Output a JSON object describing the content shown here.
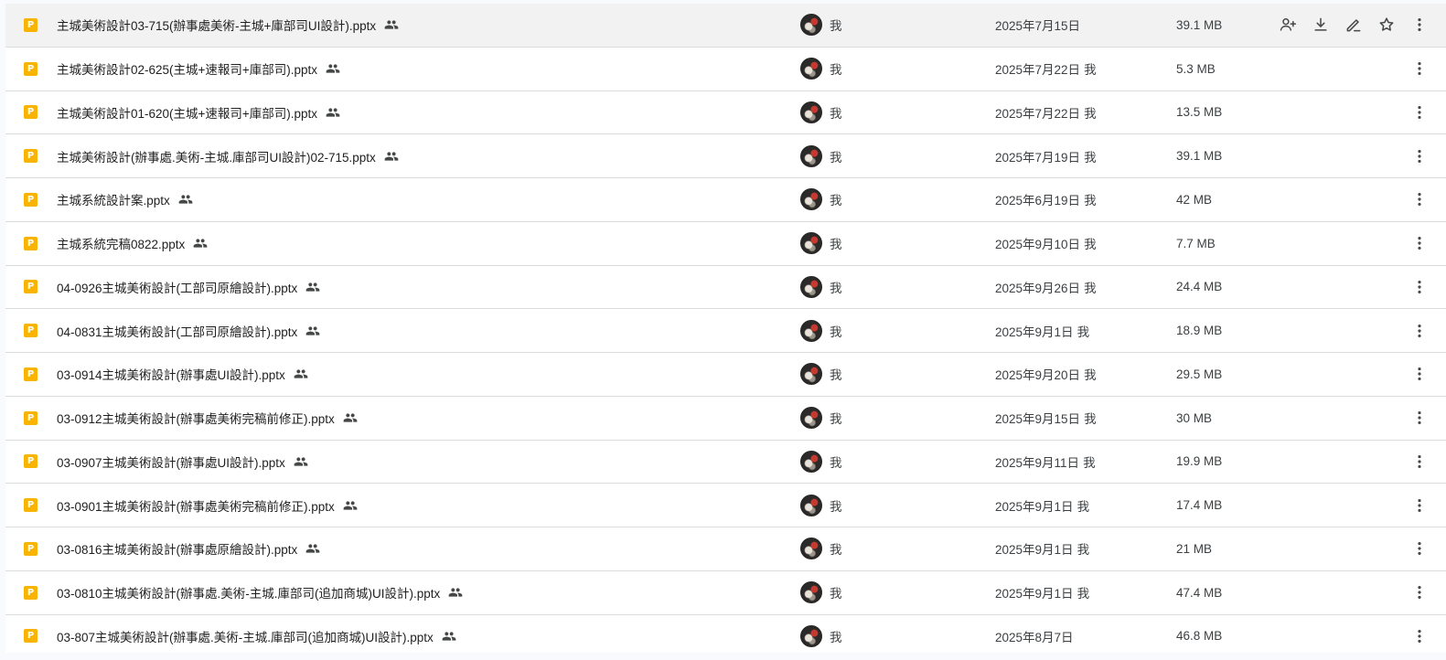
{
  "colors": {
    "file_type_badge": "#f8b400",
    "row_hover": "#f2f2f2",
    "divider": "#dadce0",
    "text": "#1f1f1f"
  },
  "file_type_letter": "P",
  "owner_label": "我",
  "hover_actions": [
    "share-icon",
    "download-icon",
    "rename-icon",
    "star-icon"
  ],
  "files": [
    {
      "name": "主城美術設計03-715(辦事處美術-主城+庫部司UI設計).pptx",
      "owner": "我",
      "modified": "2025年7月15日",
      "modified_by": "",
      "size": "39.1 MB",
      "hovered": true
    },
    {
      "name": "主城美術設計02-625(主城+速報司+庫部司).pptx",
      "owner": "我",
      "modified": "2025年7月22日",
      "modified_by": "我",
      "size": "5.3 MB"
    },
    {
      "name": "主城美術設計01-620(主城+速報司+庫部司).pptx",
      "owner": "我",
      "modified": "2025年7月22日",
      "modified_by": "我",
      "size": "13.5 MB"
    },
    {
      "name": "主城美術設計(辦事處.美術-主城.庫部司UI設計)02-715.pptx",
      "owner": "我",
      "modified": "2025年7月19日",
      "modified_by": "我",
      "size": "39.1 MB"
    },
    {
      "name": "主城系統設計案.pptx",
      "owner": "我",
      "modified": "2025年6月19日",
      "modified_by": "我",
      "size": "42 MB"
    },
    {
      "name": "主城系統完稿0822.pptx",
      "owner": "我",
      "modified": "2025年9月10日",
      "modified_by": "我",
      "size": "7.7 MB"
    },
    {
      "name": "04-0926主城美術設計(工部司原繪設計).pptx",
      "owner": "我",
      "modified": "2025年9月26日",
      "modified_by": "我",
      "size": "24.4 MB"
    },
    {
      "name": "04-0831主城美術設計(工部司原繪設計).pptx",
      "owner": "我",
      "modified": "2025年9月1日",
      "modified_by": "我",
      "size": "18.9 MB"
    },
    {
      "name": "03-0914主城美術設計(辦事處UI設計).pptx",
      "owner": "我",
      "modified": "2025年9月20日",
      "modified_by": "我",
      "size": "29.5 MB"
    },
    {
      "name": "03-0912主城美術設計(辦事處美術完稿前修正).pptx",
      "owner": "我",
      "modified": "2025年9月15日",
      "modified_by": "我",
      "size": "30 MB"
    },
    {
      "name": "03-0907主城美術設計(辦事處UI設計).pptx",
      "owner": "我",
      "modified": "2025年9月11日",
      "modified_by": "我",
      "size": "19.9 MB"
    },
    {
      "name": "03-0901主城美術設計(辦事處美術完稿前修正).pptx",
      "owner": "我",
      "modified": "2025年9月1日",
      "modified_by": "我",
      "size": "17.4 MB"
    },
    {
      "name": "03-0816主城美術設計(辦事處原繪設計).pptx",
      "owner": "我",
      "modified": "2025年9月1日",
      "modified_by": "我",
      "size": "21 MB"
    },
    {
      "name": "03-0810主城美術設計(辦事處.美術-主城.庫部司(追加商城)UI設計).pptx",
      "owner": "我",
      "modified": "2025年9月1日",
      "modified_by": "我",
      "size": "47.4 MB"
    },
    {
      "name": "03-807主城美術設計(辦事處.美術-主城.庫部司(追加商城)UI設計).pptx",
      "owner": "我",
      "modified": "2025年8月7日",
      "modified_by": "",
      "size": "46.8 MB"
    }
  ]
}
